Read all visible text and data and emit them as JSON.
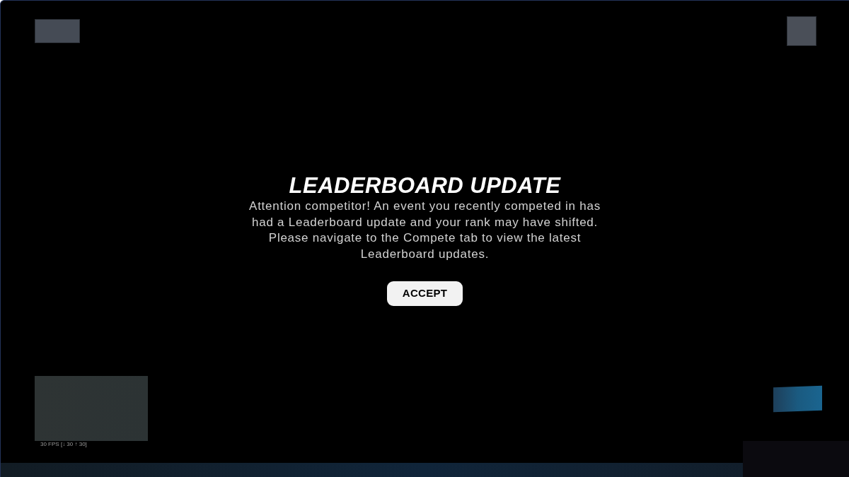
{
  "dialog": {
    "title": "LEADERBOARD UPDATE",
    "message": "Attention competitor! An event you recently competed in has had a Leaderboard update and your rank may have shifted. Please navigate to the Compete tab to view the latest Leaderboard updates.",
    "button": "ACCEPT"
  },
  "overlay": {
    "fps_counter": "30 FPS [↓ 30 ↑ 30]"
  }
}
